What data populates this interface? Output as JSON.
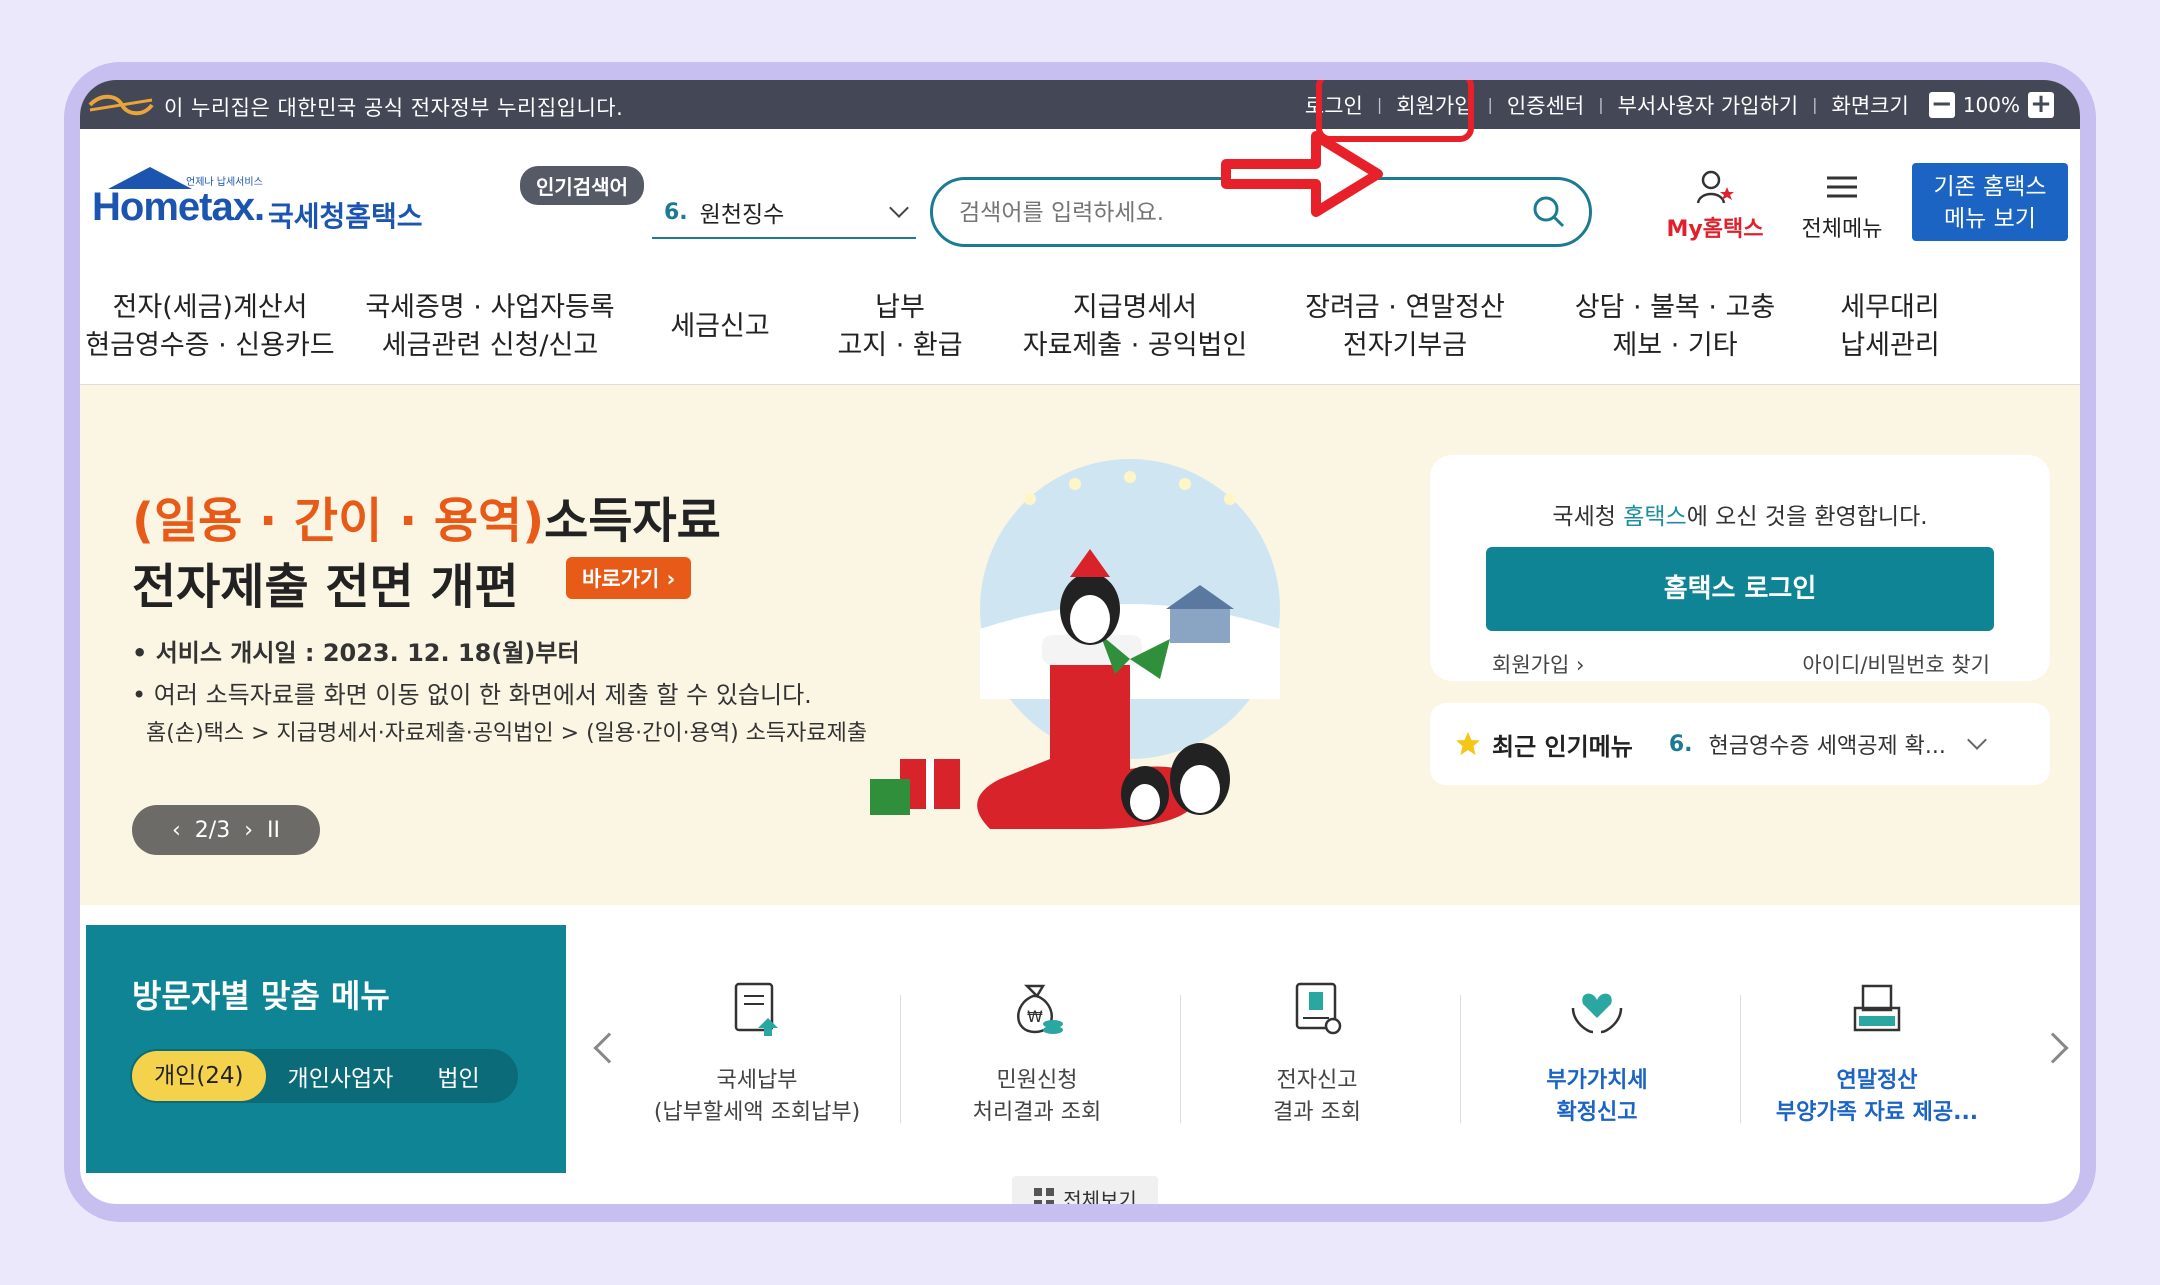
{
  "gov_bar": {
    "notice": "이 누리집은 대한민국 공식 전자정부 누리집입니다.",
    "links": [
      "로그인",
      "회원가입",
      "인증센터",
      "부서사용자 가입하기",
      "화면크기"
    ],
    "zoom_minus": "−",
    "zoom_value": "100%",
    "zoom_plus": "+"
  },
  "header": {
    "logo_small": "언제나 납세서비스",
    "logo_main": "Hometax.",
    "logo_sub": "국세청홈택스",
    "popular_badge": "인기검색어",
    "popular_rank": "6.",
    "popular_term": "원천징수",
    "search_placeholder": "검색어를 입력하세요.",
    "my_hometax": "My홈택스",
    "all_menu": "전체메뉴",
    "legacy_line1": "기존 홈택스",
    "legacy_line2": "메뉴 보기"
  },
  "nav": [
    {
      "line1": "전자(세금)계산서",
      "line2": "현금영수증 · 신용카드"
    },
    {
      "line1": "국세증명 · 사업자등록",
      "line2": "세금관련 신청/신고"
    },
    {
      "line1": "세금신고",
      "line2": ""
    },
    {
      "line1": "납부",
      "line2": "고지 · 환급"
    },
    {
      "line1": "지급명세서",
      "line2": "자료제출 · 공익법인"
    },
    {
      "line1": "장려금 · 연말정산",
      "line2": "전자기부금"
    },
    {
      "line1": "상담 · 불복 · 고충",
      "line2": "제보 · 기타"
    },
    {
      "line1": "세무대리",
      "line2": "납세관리"
    }
  ],
  "banner": {
    "title_orange": "(일용 · 간이 · 용역)",
    "title_rest": "소득자료",
    "title_line2": "전자제출 전면 개편",
    "shortcut": "바로가기 ›",
    "bullet1": "• 서비스 개시일 : 2023. 12. 18(월)부터",
    "bullet2": "• 여러 소득자료를 화면 이동 없이 한 화면에서 제출 할 수 있습니다.",
    "bullet3": "홈(손)택스 > 지급명세서·자료제출·공익법인 > (일용·간이·용역) 소득자료제출",
    "slide_prev": "‹",
    "slide_counter": "2/3",
    "slide_next": "›",
    "slide_pause": "II"
  },
  "login": {
    "welcome_prefix": "국세청 ",
    "welcome_brand": "홈택스",
    "welcome_suffix": "에 오신 것을 환영합니다.",
    "button": "홈택스 로그인",
    "signup": "회원가입 ›",
    "find": "아이디/비밀번호 찾기"
  },
  "popular_menu": {
    "label": "최근 인기메뉴",
    "rank": "6.",
    "text": "현금영수증 세액공제 확..."
  },
  "visitor": {
    "title": "방문자별 맞춤 메뉴",
    "tabs": [
      "개인(24)",
      "개인사업자",
      "법인"
    ]
  },
  "services": [
    {
      "line1": "국세납부",
      "line2": "(납부할세액 조회납부)",
      "icon": "tax-payment-icon"
    },
    {
      "line1": "민원신청",
      "line2": "처리결과 조회",
      "icon": "money-bag-icon"
    },
    {
      "line1": "전자신고",
      "line2": "결과 조회",
      "icon": "e-filing-icon"
    },
    {
      "line1": "부가가치세",
      "line2": "확정신고",
      "icon": "heart-hands-icon"
    },
    {
      "line1": "연말정산",
      "line2": "부양가족 자료 제공...",
      "icon": "tray-icon"
    }
  ],
  "view_all": "전체보기",
  "colors": {
    "teal": "#0f8494",
    "highlight_red": "#e8202a",
    "orange": "#e75a18",
    "blue": "#1b64c4"
  }
}
